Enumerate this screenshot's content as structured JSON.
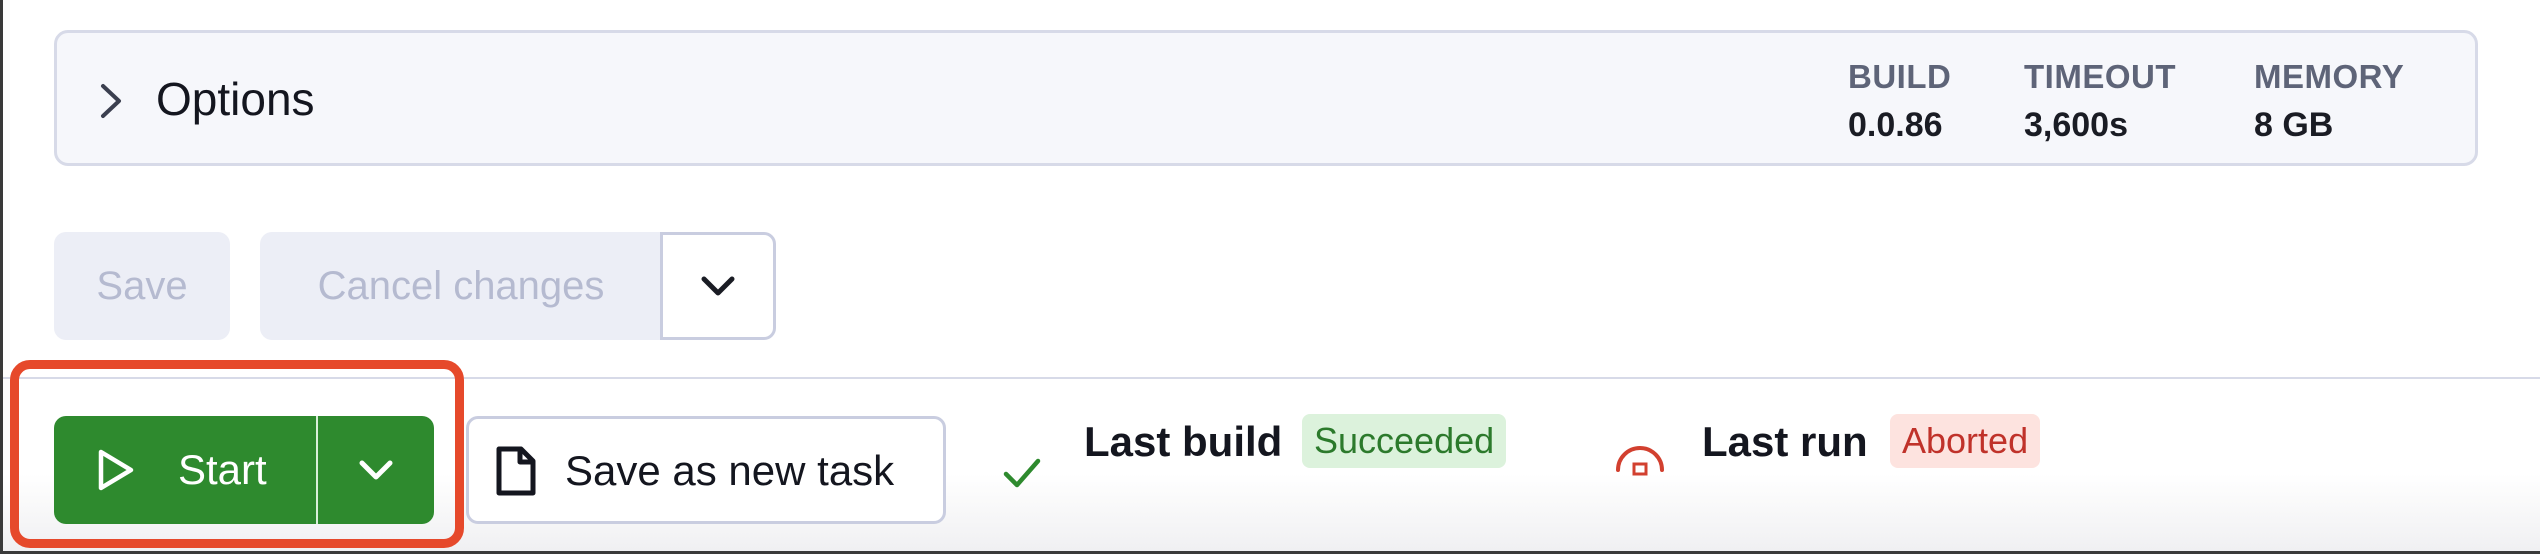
{
  "options": {
    "title": "Options",
    "stats": [
      {
        "label": "BUILD",
        "value": "0.0.86"
      },
      {
        "label": "TIMEOUT",
        "value": "3,600s"
      },
      {
        "label": "MEMORY",
        "value": "8 GB"
      }
    ]
  },
  "actions": {
    "save_label": "Save",
    "cancel_label": "Cancel changes"
  },
  "toolbar": {
    "start_label": "Start",
    "save_task_label": "Save as new task"
  },
  "status": {
    "last_build_label": "Last build",
    "last_build_badge": "Succeeded",
    "last_run_label": "Last run",
    "last_run_badge": "Aborted"
  },
  "colors": {
    "primary_green": "#2e8a2e",
    "highlight": "#e6492b",
    "success_bg": "#dcf2dc",
    "aborted_bg": "#fde3df"
  }
}
